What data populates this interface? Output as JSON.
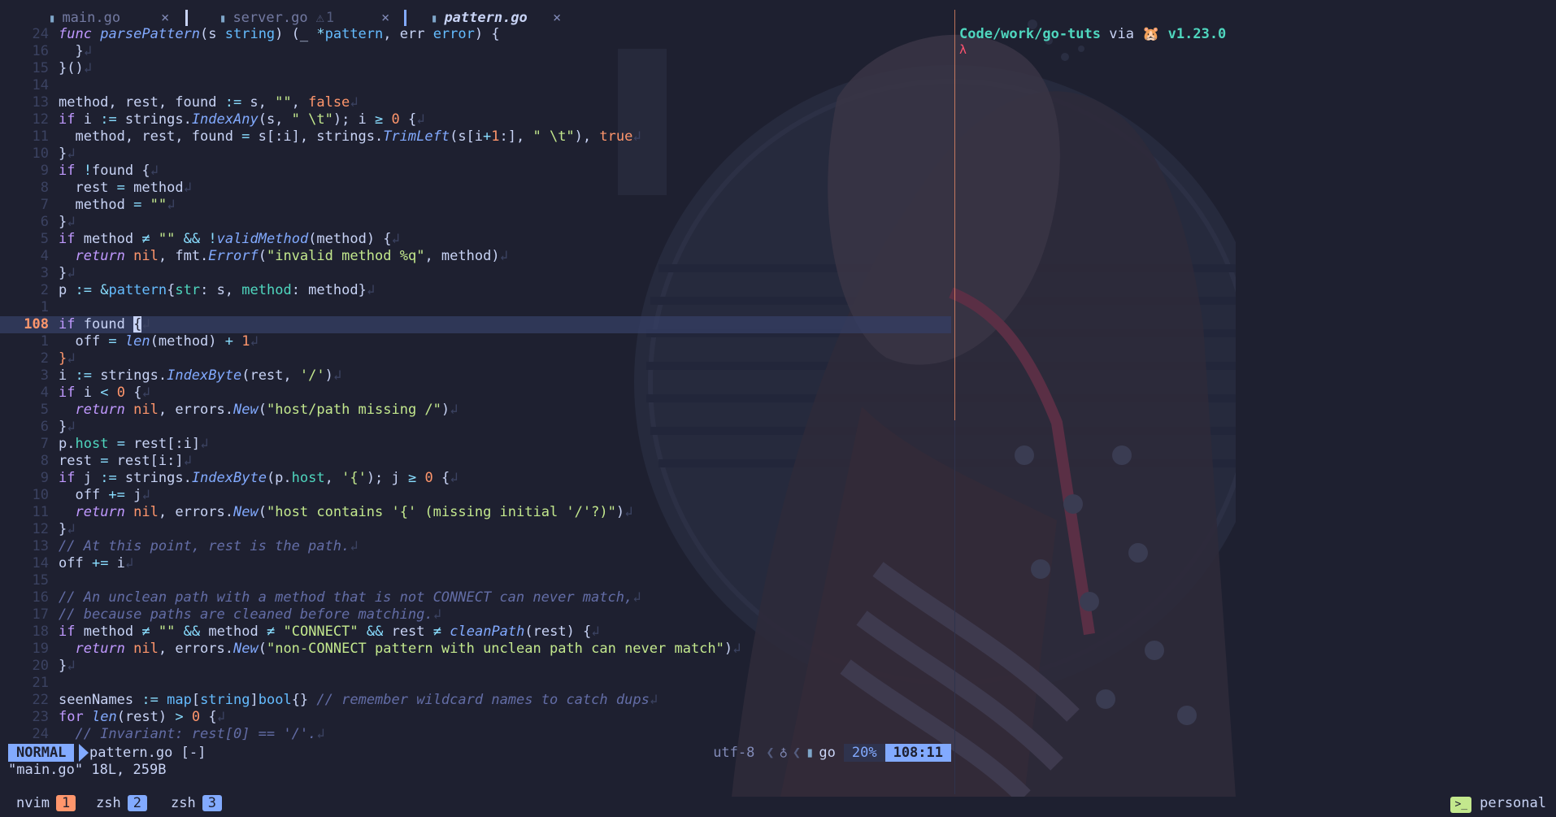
{
  "tabs": [
    {
      "name": "main.go",
      "close": "×"
    },
    {
      "name": "server.go",
      "warning": "1",
      "close": "×"
    },
    {
      "name": "pattern.go",
      "close": "×"
    }
  ],
  "code_lines": [
    {
      "n": "24",
      "html": "<span class=\"ki\">func</span> <span class=\"f\">parsePattern</span>(s <span class=\"t\">string</span>) (_ <span class=\"op\">*</span><span class=\"t\">pattern</span>, err <span class=\"t\">error</span>) {"
    },
    {
      "n": "16",
      "html": "  }<span class=\"nl\">↲</span>"
    },
    {
      "n": "15",
      "html": "}()<span class=\"nl\">↲</span>"
    },
    {
      "n": "14",
      "html": ""
    },
    {
      "n": "13",
      "html": "method, rest, found <span class=\"op\">:=</span> s, <span class=\"s\">\"\"</span>, <span class=\"n\">false</span><span class=\"nl\">↲</span>"
    },
    {
      "n": "12",
      "html": "<span class=\"k\">if</span> i <span class=\"op\">:=</span> strings.<span class=\"f\">IndexAny</span>(s, <span class=\"s\">\" \\t\"</span>); i <span class=\"op\">≥</span> <span class=\"n\">0</span> {<span class=\"nl\">↲</span>"
    },
    {
      "n": "11",
      "html": "  method, rest, found <span class=\"op\">=</span> s[:i], strings.<span class=\"f\">TrimLeft</span>(s[i<span class=\"op\">+</span><span class=\"n\">1</span>:], <span class=\"s\">\" \\t\"</span>), <span class=\"n\">true</span><span class=\"nl\">↲</span>"
    },
    {
      "n": "10",
      "html": "}<span class=\"nl\">↲</span>"
    },
    {
      "n": "9",
      "html": "<span class=\"k\">if</span> <span class=\"op\">!</span>found {<span class=\"nl\">↲</span>"
    },
    {
      "n": "8",
      "html": "  rest <span class=\"op\">=</span> method<span class=\"nl\">↲</span>"
    },
    {
      "n": "7",
      "html": "  method <span class=\"op\">=</span> <span class=\"s\">\"\"</span><span class=\"nl\">↲</span>"
    },
    {
      "n": "6",
      "html": "}<span class=\"nl\">↲</span>"
    },
    {
      "n": "5",
      "html": "<span class=\"k\">if</span> method <span class=\"op\">≠</span> <span class=\"s\">\"\"</span> <span class=\"op\">&amp;&amp;</span> <span class=\"op\">!</span><span class=\"f\">validMethod</span>(method) {<span class=\"nl\">↲</span>"
    },
    {
      "n": "4",
      "html": "  <span class=\"ki\">return</span> <span class=\"n\">nil</span>, fmt.<span class=\"f\">Errorf</span>(<span class=\"s\">\"invalid method %q\"</span>, method)<span class=\"nl\">↲</span>"
    },
    {
      "n": "3",
      "html": "}<span class=\"nl\">↲</span>"
    },
    {
      "n": "2",
      "html": "p <span class=\"op\">:=</span> <span class=\"op\">&amp;</span><span class=\"t\">pattern</span>{<span class=\"fld\">str</span>: s, <span class=\"fld\">method</span>: method}<span class=\"nl\">↲</span>"
    },
    {
      "n": "1",
      "html": ""
    },
    {
      "n": "108",
      "html": "<span class=\"k\">if</span> found <span class=\"cursor\">{</span><span class=\"nl\">↲</span>",
      "current": true
    },
    {
      "n": "1",
      "html": "  off <span class=\"op\">=</span> <span class=\"f\">len</span>(method) <span class=\"op\">+</span> <span class=\"n\">1</span><span class=\"nl\">↲</span>"
    },
    {
      "n": "2",
      "html": "<span class=\"n\">}</span><span class=\"nl\">↲</span>"
    },
    {
      "n": "3",
      "html": "i <span class=\"op\">:=</span> strings.<span class=\"f\">IndexByte</span>(rest, <span class=\"s\">'/'</span>)<span class=\"nl\">↲</span>"
    },
    {
      "n": "4",
      "html": "<span class=\"k\">if</span> i <span class=\"op\">&lt;</span> <span class=\"n\">0</span> {<span class=\"nl\">↲</span>"
    },
    {
      "n": "5",
      "html": "  <span class=\"ki\">return</span> <span class=\"n\">nil</span>, errors.<span class=\"f\">New</span>(<span class=\"s\">\"host/path missing /\"</span>)<span class=\"nl\">↲</span>"
    },
    {
      "n": "6",
      "html": "}<span class=\"nl\">↲</span>"
    },
    {
      "n": "7",
      "html": "p.<span class=\"fld\">host</span> <span class=\"op\">=</span> rest[:i]<span class=\"nl\">↲</span>"
    },
    {
      "n": "8",
      "html": "rest <span class=\"op\">=</span> rest[i:]<span class=\"nl\">↲</span>"
    },
    {
      "n": "9",
      "html": "<span class=\"k\">if</span> j <span class=\"op\">:=</span> strings.<span class=\"f\">IndexByte</span>(p.<span class=\"fld\">host</span>, <span class=\"s\">'{'</span>); j <span class=\"op\">≥</span> <span class=\"n\">0</span> {<span class=\"nl\">↲</span>"
    },
    {
      "n": "10",
      "html": "  off <span class=\"op\">+=</span> j<span class=\"nl\">↲</span>"
    },
    {
      "n": "11",
      "html": "  <span class=\"ki\">return</span> <span class=\"n\">nil</span>, errors.<span class=\"f\">New</span>(<span class=\"s\">\"host contains '{' (missing initial '/'?)\"</span>)<span class=\"nl\">↲</span>"
    },
    {
      "n": "12",
      "html": "}<span class=\"nl\">↲</span>"
    },
    {
      "n": "13",
      "html": "<span class=\"c\">// At this point, rest is the path.</span><span class=\"nl\">↲</span>"
    },
    {
      "n": "14",
      "html": "off <span class=\"op\">+=</span> i<span class=\"nl\">↲</span>"
    },
    {
      "n": "15",
      "html": ""
    },
    {
      "n": "16",
      "html": "<span class=\"c\">// An unclean path with a method that is not CONNECT can never match,</span><span class=\"nl\">↲</span>"
    },
    {
      "n": "17",
      "html": "<span class=\"c\">// because paths are cleaned before matching.</span><span class=\"nl\">↲</span>"
    },
    {
      "n": "18",
      "html": "<span class=\"k\">if</span> method <span class=\"op\">≠</span> <span class=\"s\">\"\"</span> <span class=\"op\">&amp;&amp;</span> method <span class=\"op\">≠</span> <span class=\"s\">\"CONNECT\"</span> <span class=\"op\">&amp;&amp;</span> rest <span class=\"op\">≠</span> <span class=\"f\">cleanPath</span>(rest) {<span class=\"nl\">↲</span>"
    },
    {
      "n": "19",
      "html": "  <span class=\"ki\">return</span> <span class=\"n\">nil</span>, errors.<span class=\"f\">New</span>(<span class=\"s\">\"non-CONNECT pattern with unclean path can never match\"</span>)<span class=\"nl\">↲</span>"
    },
    {
      "n": "20",
      "html": "}<span class=\"nl\">↲</span>"
    },
    {
      "n": "21",
      "html": ""
    },
    {
      "n": "22",
      "html": "seenNames <span class=\"op\">:=</span> <span class=\"t\">map</span>[<span class=\"t\">string</span>]<span class=\"t\">bool</span>{} <span class=\"c\">// remember wildcard names to catch dups</span><span class=\"nl\">↲</span>"
    },
    {
      "n": "23",
      "html": "<span class=\"k\">for</span> <span class=\"f\">len</span>(rest) <span class=\"op\">&gt;</span> <span class=\"n\">0</span> {<span class=\"nl\">↲</span>"
    },
    {
      "n": "24",
      "html": "  <span class=\"c\">// Invariant: rest[0] == '/'.</span><span class=\"nl\">↲</span>"
    }
  ],
  "terminal": {
    "path": "Code/work/go-tuts",
    "via": "via",
    "version_icon": "🐹",
    "version": "v1.23.0",
    "prompt": "λ"
  },
  "statusline": {
    "mode": "NORMAL",
    "file": "pattern.go",
    "modified": "[-]",
    "encoding": "utf-8",
    "os_icon": "linux-icon",
    "lang": "go",
    "percent": "20%",
    "position": "108:11"
  },
  "cmdline": "\"main.go\" 18L, 259B",
  "tmux": {
    "windows": [
      {
        "name": "nvim",
        "num": "1"
      },
      {
        "name": "zsh",
        "num": "2"
      },
      {
        "name": "zsh",
        "num": "3"
      }
    ],
    "session": "personal"
  },
  "colors": {
    "bg": "#1e2030",
    "accent": "#82aaff",
    "orange": "#ff966c",
    "green": "#c3e88d"
  }
}
